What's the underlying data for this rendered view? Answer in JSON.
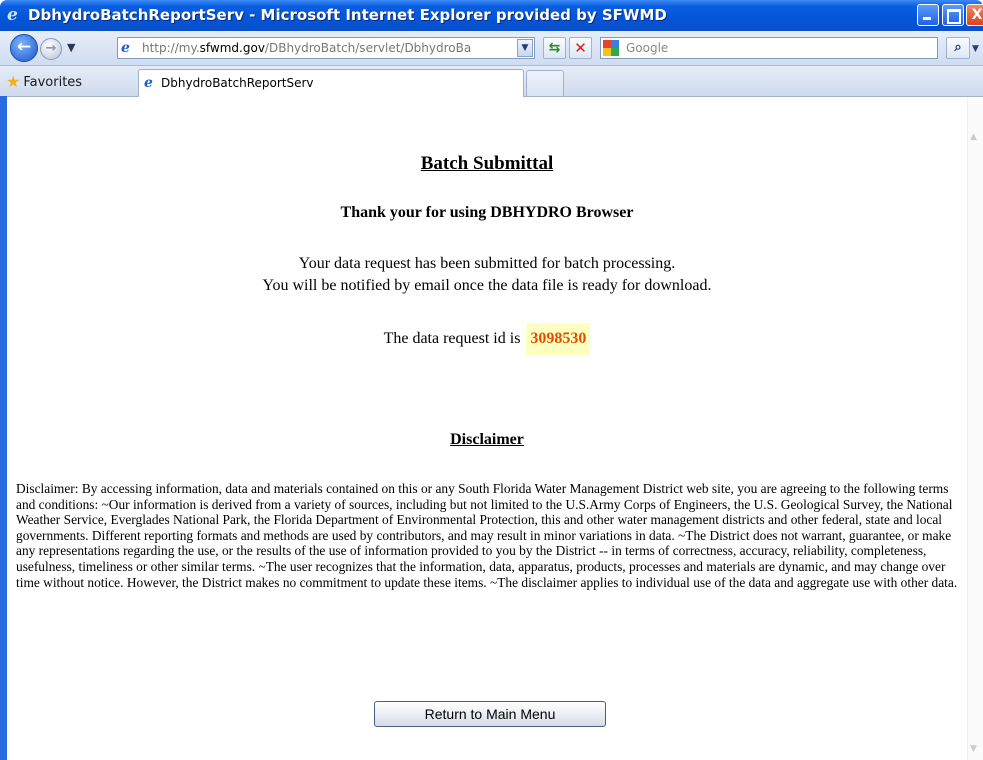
{
  "window": {
    "title": "DbhydroBatchReportServ - Microsoft Internet Explorer provided by SFWMD",
    "controls": {
      "minimize": "minimize",
      "maximize": "maximize",
      "close": "X"
    }
  },
  "navbar": {
    "address_prefix": "http://my.",
    "address_domain": "sfwmd.gov",
    "address_path": "/DBhydroBatch/servlet/DbhydroBa",
    "search_placeholder": "Google"
  },
  "tabs": {
    "favorites_label": "Favorites",
    "active_tab_label": "DbhydroBatchReportServ"
  },
  "page": {
    "heading": "Batch Submittal",
    "thank_you": "Thank your for using DBHYDRO Browser",
    "message_line1": "Your data request has been submitted for batch processing.",
    "message_line2": "You will be notified by email once the data file is ready for download.",
    "request_id_label": "The data request id is",
    "request_id": "3098530",
    "disclaimer_heading": "Disclaimer",
    "disclaimer_text": "Disclaimer: By accessing information, data and materials contained on this or any South Florida Water Management District web site, you are agreeing to the following terms and conditions: ~Our information is derived from a variety of sources, including but not limited to the U.S.Army Corps of Engineers, the U.S. Geological Survey, the National Weather Service, Everglades National Park, the Florida Department of Environmental Protection, this and other water management districts and other federal, state and local governments. Different reporting formats and methods are used by contributors, and may result in minor variations in data. ~The District does not warrant, guarantee, or make any representations regarding the use, or the results of the use of information provided to you by the District -- in terms of correctness, accuracy, reliability, completeness, usefulness, timeliness or other similar terms. ~The user recognizes that the information, data, apparatus, products, processes and materials are dynamic, and may change over time without notice. However, the District makes no commitment to update these items. ~The disclaimer applies to individual use of the data and aggregate use with other data.",
    "return_button": "Return to Main Menu"
  },
  "colors": {
    "titlebar": "#0455d8",
    "request_id_text": "#e84a00",
    "request_id_highlight": "#ffffbf"
  }
}
